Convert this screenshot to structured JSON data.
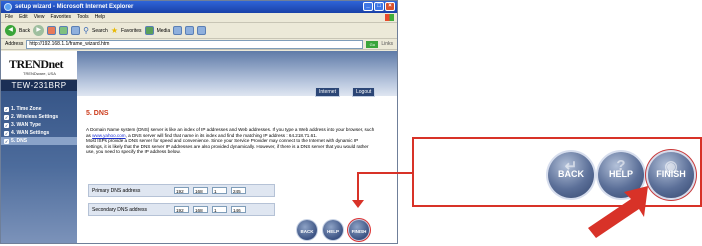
{
  "window": {
    "title": "setup wizard - Microsoft Internet Explorer",
    "controls": [
      "_",
      "□",
      "×"
    ]
  },
  "menu": [
    "File",
    "Edit",
    "View",
    "Favorites",
    "Tools",
    "Help"
  ],
  "toolbar": {
    "back": "Back",
    "search": "Search",
    "favorites": "Favorites",
    "media": "Media"
  },
  "address": {
    "label": "Address",
    "url": "http://192.168.1.1/frame_wizard.htm",
    "go": "Go",
    "links": "Links"
  },
  "router": {
    "brand": "TRENDnet",
    "tagline": "TRENDware, USA",
    "model": "TEW-231BRP",
    "header_buttons": [
      "Internet",
      "Logout"
    ]
  },
  "wizard_steps": [
    {
      "label": "1. Time Zone",
      "current": false
    },
    {
      "label": "2. Wireless Settings",
      "current": false
    },
    {
      "label": "3. WAN Type",
      "current": false
    },
    {
      "label": "4. WAN Settings",
      "current": false
    },
    {
      "label": "5. DNS",
      "current": true
    }
  ],
  "section": {
    "title": "5. DNS",
    "desc_1": "A Domain Name system (DNS) server is like an index of IP addresses and Web addresses. If you type a Web address into your browser, such as ",
    "desc_link": "www.yahoo.com",
    "desc_2": ", a DNS server will find that name in its index and find the matching IP address : 64.218.71.61.",
    "desc_3": "Most ISPs provide a DNS server for speed and convenience. Since your Service Provider may connect to the Internet with dynamic IP settings, it is likely that the DNS server IP addresses are also provided dynamically. However, if there is a DNS server that you would rather use, you need to specify the IP address below."
  },
  "dns": {
    "primary_label": "Primary DNS address",
    "primary": [
      "192",
      "168",
      "1",
      "245"
    ],
    "secondary_label": "Secondary DNS address",
    "secondary": [
      "192",
      "168",
      "1",
      "146"
    ]
  },
  "nav_buttons": {
    "back": "BACK",
    "help": "HELP",
    "finish": "FINISH"
  },
  "callout": {
    "back": "BACK",
    "help": "HELP",
    "finish": "FINISH",
    "arrow_color": "#d83228"
  }
}
